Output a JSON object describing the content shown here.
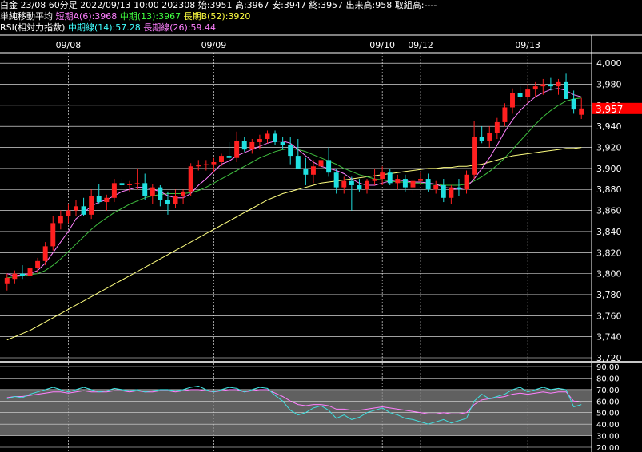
{
  "header": {
    "line1": "白金 23/08 60分足 2022/09/13 10:00 202308 始:3951 高:3967 安:3947 終:3957 出来高:958 取組高:----",
    "ma_label": "単純移動平均",
    "ma_a": "短期A(6):3968",
    "ma_mid": "中期(13):3967",
    "ma_b": "長期B(52):3920",
    "rsi_label": "RSI(相対力指数)",
    "rsi_mid": "中期線(14):57.28",
    "rsi_long": "長期線(26):59.44"
  },
  "colors": {
    "background": "#000000",
    "grid": "#ffffff",
    "candle_up": "#ff2020",
    "candle_down": "#20e0e0",
    "ma_short": "#ff80ff",
    "ma_mid": "#40c040",
    "ma_long": "#ffff80",
    "rsi_mid": "#40e0e0",
    "rsi_long": "#ff80ff",
    "last_price_bg": "#ff0000"
  },
  "chart_data": {
    "type": "candlestick",
    "x_date_labels": [
      {
        "label": "09/08",
        "index": 8
      },
      {
        "label": "09/09",
        "index": 27
      },
      {
        "label": "09/10",
        "index": 49
      },
      {
        "label": "09/12",
        "index": 54
      },
      {
        "label": "09/13",
        "index": 68
      }
    ],
    "ylim": [
      3720,
      4010
    ],
    "yticks": [
      4000,
      3980,
      3960,
      3940,
      3920,
      3900,
      3880,
      3860,
      3840,
      3820,
      3800,
      3780,
      3760,
      3740,
      3720
    ],
    "ytick_labels": [
      "4,000",
      "3,980",
      "3,960",
      "3,940",
      "3,920",
      "3,900",
      "3,880",
      "3,860",
      "3,840",
      "3,820",
      "3,800",
      "3,780",
      "3,760",
      "3,740",
      "3,720"
    ],
    "last_price": 3957,
    "last_price_label": "3,957",
    "ohlc": [
      [
        3790,
        3800,
        3784,
        3796
      ],
      [
        3795,
        3803,
        3790,
        3800
      ],
      [
        3800,
        3808,
        3795,
        3798
      ],
      [
        3798,
        3808,
        3792,
        3805
      ],
      [
        3805,
        3815,
        3800,
        3812
      ],
      [
        3812,
        3830,
        3808,
        3826
      ],
      [
        3826,
        3855,
        3822,
        3848
      ],
      [
        3848,
        3860,
        3842,
        3855
      ],
      [
        3855,
        3866,
        3848,
        3860
      ],
      [
        3860,
        3870,
        3855,
        3864
      ],
      [
        3864,
        3872,
        3855,
        3856
      ],
      [
        3856,
        3880,
        3852,
        3874
      ],
      [
        3874,
        3885,
        3866,
        3868
      ],
      [
        3868,
        3875,
        3860,
        3872
      ],
      [
        3872,
        3890,
        3868,
        3886
      ],
      [
        3886,
        3890,
        3880,
        3884
      ],
      [
        3884,
        3888,
        3878,
        3885
      ],
      [
        3885,
        3900,
        3880,
        3886
      ],
      [
        3886,
        3895,
        3870,
        3874
      ],
      [
        3874,
        3885,
        3866,
        3882
      ],
      [
        3882,
        3884,
        3864,
        3870
      ],
      [
        3870,
        3878,
        3856,
        3866
      ],
      [
        3866,
        3880,
        3862,
        3874
      ],
      [
        3874,
        3880,
        3866,
        3878
      ],
      [
        3878,
        3905,
        3874,
        3902
      ],
      [
        3902,
        3908,
        3898,
        3903
      ],
      [
        3903,
        3908,
        3898,
        3904
      ],
      [
        3904,
        3910,
        3896,
        3906
      ],
      [
        3906,
        3914,
        3902,
        3912
      ],
      [
        3912,
        3925,
        3904,
        3910
      ],
      [
        3910,
        3935,
        3906,
        3926
      ],
      [
        3926,
        3930,
        3916,
        3918
      ],
      [
        3918,
        3928,
        3914,
        3925
      ],
      [
        3925,
        3932,
        3918,
        3928
      ],
      [
        3928,
        3936,
        3924,
        3933
      ],
      [
        3933,
        3936,
        3922,
        3925
      ],
      [
        3925,
        3930,
        3918,
        3922
      ],
      [
        3922,
        3930,
        3904,
        3912
      ],
      [
        3912,
        3928,
        3906,
        3900
      ],
      [
        3900,
        3910,
        3884,
        3894
      ],
      [
        3894,
        3908,
        3886,
        3902
      ],
      [
        3902,
        3912,
        3896,
        3908
      ],
      [
        3908,
        3920,
        3892,
        3896
      ],
      [
        3896,
        3900,
        3876,
        3882
      ],
      [
        3882,
        3892,
        3876,
        3888
      ],
      [
        3888,
        3892,
        3860,
        3884
      ],
      [
        3884,
        3890,
        3878,
        3880
      ],
      [
        3880,
        3890,
        3876,
        3888
      ],
      [
        3888,
        3900,
        3884,
        3890
      ],
      [
        3890,
        3902,
        3884,
        3896
      ],
      [
        3896,
        3900,
        3884,
        3886
      ],
      [
        3886,
        3894,
        3880,
        3890
      ],
      [
        3890,
        3894,
        3878,
        3882
      ],
      [
        3882,
        3890,
        3876,
        3888
      ],
      [
        3888,
        3896,
        3884,
        3890
      ],
      [
        3890,
        3895,
        3878,
        3880
      ],
      [
        3880,
        3888,
        3876,
        3884
      ],
      [
        3884,
        3890,
        3868,
        3872
      ],
      [
        3872,
        3884,
        3866,
        3882
      ],
      [
        3882,
        3890,
        3874,
        3880
      ],
      [
        3880,
        3898,
        3876,
        3894
      ],
      [
        3894,
        3945,
        3890,
        3930
      ],
      [
        3930,
        3940,
        3924,
        3926
      ],
      [
        3926,
        3940,
        3920,
        3934
      ],
      [
        3934,
        3948,
        3928,
        3944
      ],
      [
        3944,
        3962,
        3940,
        3958
      ],
      [
        3958,
        3976,
        3952,
        3972
      ],
      [
        3972,
        3978,
        3964,
        3968
      ],
      [
        3968,
        3980,
        3962,
        3975
      ],
      [
        3975,
        3982,
        3968,
        3978
      ],
      [
        3978,
        3985,
        3970,
        3980
      ],
      [
        3980,
        3986,
        3974,
        3978
      ],
      [
        3978,
        3985,
        3970,
        3982
      ],
      [
        3982,
        3990,
        3966,
        3966
      ],
      [
        3966,
        3974,
        3952,
        3956
      ],
      [
        3951,
        3967,
        3947,
        3957
      ]
    ],
    "ma_short": [
      3800,
      3798,
      3799,
      3800,
      3803,
      3810,
      3820,
      3830,
      3840,
      3852,
      3858,
      3864,
      3868,
      3870,
      3874,
      3878,
      3880,
      3882,
      3882,
      3880,
      3878,
      3874,
      3872,
      3872,
      3876,
      3884,
      3890,
      3897,
      3904,
      3907,
      3912,
      3915,
      3918,
      3921,
      3924,
      3926,
      3926,
      3924,
      3918,
      3912,
      3906,
      3902,
      3900,
      3898,
      3895,
      3890,
      3886,
      3884,
      3884,
      3886,
      3888,
      3889,
      3888,
      3887,
      3887,
      3886,
      3885,
      3882,
      3881,
      3880,
      3882,
      3890,
      3900,
      3910,
      3922,
      3935,
      3946,
      3955,
      3962,
      3968,
      3972,
      3975,
      3976,
      3974,
      3970,
      3968
    ],
    "ma_mid": [
      3796,
      3797,
      3798,
      3799,
      3800,
      3803,
      3808,
      3814,
      3821,
      3828,
      3835,
      3842,
      3848,
      3853,
      3858,
      3862,
      3866,
      3869,
      3872,
      3874,
      3875,
      3876,
      3876,
      3876,
      3877,
      3879,
      3882,
      3886,
      3890,
      3894,
      3898,
      3902,
      3906,
      3910,
      3913,
      3916,
      3918,
      3919,
      3918,
      3916,
      3913,
      3910,
      3907,
      3904,
      3900,
      3897,
      3894,
      3892,
      3890,
      3889,
      3888,
      3887,
      3887,
      3886,
      3886,
      3885,
      3885,
      3884,
      3884,
      3884,
      3885,
      3888,
      3892,
      3897,
      3903,
      3910,
      3918,
      3926,
      3934,
      3942,
      3949,
      3955,
      3960,
      3964,
      3966,
      3967
    ],
    "ma_long": [
      3737,
      3740,
      3743,
      3746,
      3750,
      3754,
      3758,
      3762,
      3766,
      3770,
      3774,
      3778,
      3782,
      3786,
      3790,
      3794,
      3798,
      3802,
      3806,
      3810,
      3814,
      3818,
      3822,
      3826,
      3830,
      3834,
      3838,
      3842,
      3846,
      3850,
      3854,
      3858,
      3862,
      3866,
      3870,
      3873,
      3876,
      3878,
      3880,
      3882,
      3884,
      3886,
      3887,
      3888,
      3889,
      3890,
      3891,
      3892,
      3893,
      3894,
      3895,
      3896,
      3897,
      3898,
      3899,
      3900,
      3900,
      3901,
      3901,
      3902,
      3902,
      3903,
      3904,
      3906,
      3908,
      3910,
      3912,
      3913,
      3914,
      3915,
      3916,
      3917,
      3918,
      3919,
      3919,
      3920
    ],
    "rsi_panel": {
      "ylim": [
        20,
        90
      ],
      "yticks": [
        90,
        80,
        70,
        60,
        50,
        40,
        30,
        20
      ],
      "ytick_labels": [
        "90.00",
        "80.00",
        "70.00",
        "60.00",
        "50.00",
        "40.00",
        "30.00",
        "20.00"
      ],
      "band": [
        30,
        70
      ],
      "rsi_mid": [
        62,
        64,
        63,
        66,
        68,
        70,
        72,
        70,
        68,
        70,
        72,
        70,
        68,
        69,
        71,
        70,
        69,
        70,
        68,
        69,
        70,
        70,
        69,
        70,
        72,
        73,
        70,
        68,
        70,
        72,
        71,
        68,
        70,
        72,
        71,
        65,
        60,
        52,
        48,
        50,
        54,
        56,
        52,
        45,
        48,
        44,
        46,
        50,
        52,
        54,
        50,
        48,
        45,
        44,
        42,
        40,
        42,
        44,
        41,
        43,
        45,
        60,
        66,
        62,
        64,
        66,
        70,
        72,
        68,
        70,
        72,
        70,
        71,
        70,
        55,
        57
      ],
      "rsi_long": [
        63,
        64,
        64,
        65,
        66,
        67,
        68,
        68,
        67,
        68,
        69,
        68,
        68,
        68,
        69,
        69,
        68,
        69,
        68,
        68,
        69,
        69,
        68,
        69,
        70,
        70,
        69,
        68,
        69,
        70,
        70,
        68,
        69,
        70,
        70,
        67,
        64,
        60,
        57,
        56,
        57,
        57,
        56,
        53,
        53,
        52,
        52,
        53,
        54,
        55,
        54,
        53,
        52,
        51,
        50,
        49,
        49,
        50,
        49,
        49,
        50,
        57,
        61,
        62,
        63,
        64,
        66,
        67,
        66,
        67,
        68,
        67,
        68,
        68,
        60,
        59
      ]
    }
  }
}
